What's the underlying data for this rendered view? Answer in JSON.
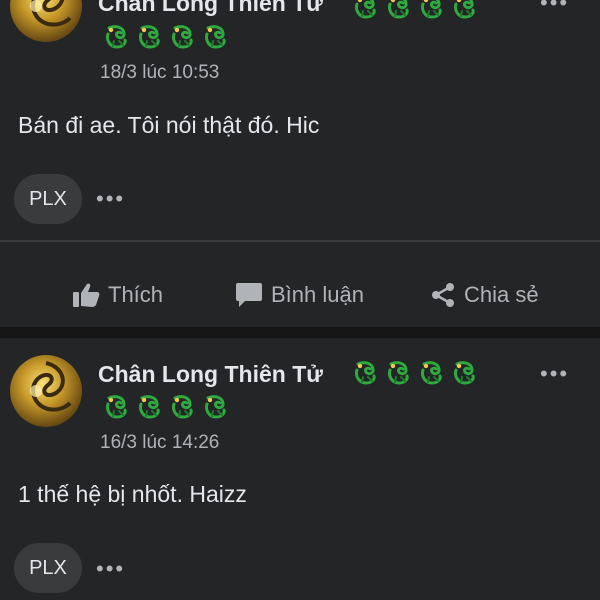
{
  "posts": [
    {
      "author": "Chân Long Thiên Tử",
      "time": "18/3 lúc 10:53",
      "text": "Bán đi ae. Tôi nói thật đó. Hic",
      "reaction_label": "PLX",
      "more": "•••"
    },
    {
      "author": "Chân Long Thiên Tử",
      "time": "16/3 lúc 14:26",
      "text": "1 thế hệ bị nhốt. Haizz",
      "reaction_label": "PLX",
      "more": "•••"
    }
  ],
  "menu": "•••",
  "actions": {
    "like": "Thích",
    "comment": "Bình luận",
    "share": "Chia sẻ"
  },
  "icons": {
    "like": "thumbs-up-icon",
    "comment": "comment-bubble-icon",
    "share": "share-icon",
    "badge": "green-dragon-icon"
  },
  "colors": {
    "background": "#242526",
    "text": "#e4e6eb",
    "muted": "#b0b3b8",
    "badge_green": "#2eaa3f"
  }
}
